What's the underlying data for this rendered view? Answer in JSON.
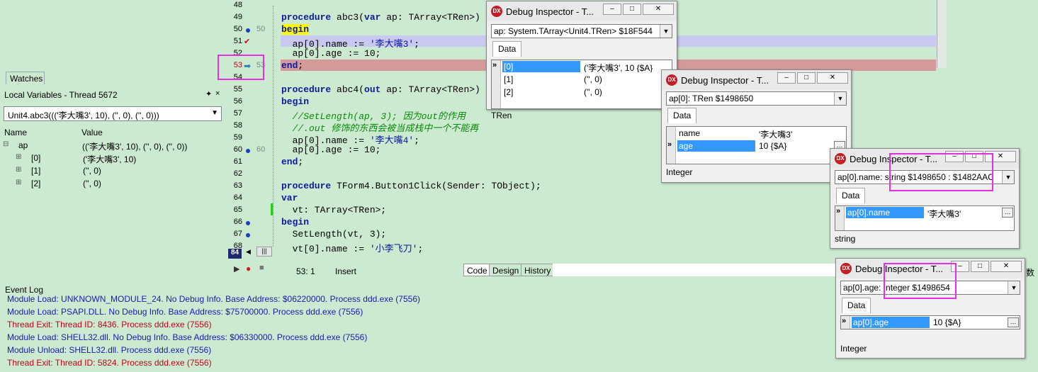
{
  "watches_tab": "Watches",
  "local_vars": {
    "title": "Local Variables - Thread 5672",
    "pin": "✦",
    "close": "×",
    "combo_value": "Unit4.abc3((('李大嘴3', 10), ('', 0), ('', 0)))",
    "col_name": "Name",
    "col_value": "Value",
    "rows": [
      {
        "expander": "⊟",
        "name": "ap",
        "value": "(('李大嘴3', 10), ('', 0), ('', 0))"
      },
      {
        "expander": "⊞",
        "name": "[0]",
        "value": "('李大嘴3', 10)"
      },
      {
        "expander": "⊞",
        "name": "[1]",
        "value": "('', 0)"
      },
      {
        "expander": "⊞",
        "name": "[2]",
        "value": "('', 0)"
      }
    ]
  },
  "editor": {
    "line_numbers": [
      "48",
      "49",
      "50",
      "51",
      "52",
      "53",
      "54",
      "55",
      "56",
      "57",
      "58",
      "59",
      "60",
      "61",
      "62",
      "63",
      "64",
      "65",
      "66",
      "67",
      "68"
    ],
    "second_numbers": {
      "50": "50",
      "53": "53",
      "60": "60"
    },
    "lines": {
      "49": [
        {
          "t": "procedure",
          "c": "kw"
        },
        {
          "t": " abc3(",
          "c": ""
        },
        {
          "t": "var",
          "c": "kw"
        },
        {
          "t": " ap: TArray<TRen>)",
          "c": ""
        }
      ],
      "50": [
        {
          "t": "begin",
          "c": "kw"
        }
      ],
      "51": [
        {
          "t": "  ap[0].name := ",
          "c": ""
        },
        {
          "t": "'李大嘴3'",
          "c": "st"
        },
        {
          "t": ";",
          "c": ""
        }
      ],
      "52": [
        {
          "t": "  ap[0].age := 10;",
          "c": ""
        }
      ],
      "53": [
        {
          "t": "end",
          "c": "kw"
        },
        {
          "t": ";",
          "c": ""
        }
      ],
      "55": [
        {
          "t": "procedure",
          "c": "kw"
        },
        {
          "t": " abc4(",
          "c": ""
        },
        {
          "t": "out",
          "c": "kw"
        },
        {
          "t": " ap: TArray<TRen>)",
          "c": ""
        }
      ],
      "56": [
        {
          "t": "begin",
          "c": "kw"
        }
      ],
      "57": [
        {
          "t": "  //SetLength(ap, 3); 因为out的作用",
          "c": "cm"
        }
      ],
      "58": [
        {
          "t": "  //.out 修饰的东西会被当成栈中一个不能再",
          "c": "cm"
        }
      ],
      "59": [
        {
          "t": "  ap[0].name := ",
          "c": ""
        },
        {
          "t": "'李大嘴4'",
          "c": "st"
        },
        {
          "t": ";",
          "c": ""
        }
      ],
      "60": [
        {
          "t": "  ap[0].age := 10;",
          "c": ""
        }
      ],
      "61": [
        {
          "t": "end",
          "c": "kw"
        },
        {
          "t": ";",
          "c": ""
        }
      ],
      "63": [
        {
          "t": "procedure",
          "c": "kw"
        },
        {
          "t": " TForm4.Button1Click(Sender: TObject);",
          "c": ""
        }
      ],
      "64": [
        {
          "t": "var",
          "c": "kw"
        }
      ],
      "65": [
        {
          "t": "  vt: TArray<TRen>;",
          "c": ""
        }
      ],
      "66": [
        {
          "t": "begin",
          "c": "kw"
        }
      ],
      "67": [
        {
          "t": "  SetLength(vt, 3);",
          "c": ""
        }
      ],
      "68": [
        {
          "t": "  vt[0].name := ",
          "c": ""
        },
        {
          "t": "'小李飞刀'",
          "c": "st"
        },
        {
          "t": ";",
          "c": ""
        }
      ]
    },
    "bottom_line_number": "84",
    "status_pos": "53:  1",
    "status_mode": "Insert",
    "tabs": [
      "Code",
      "Design",
      "History"
    ]
  },
  "event_log": {
    "title": "Event Log",
    "lines": [
      {
        "text": "Module Load: UNKNOWN_MODULE_24. No Debug Info. Base Address: $06220000. Process ddd.exe (7556)",
        "color": "blue"
      },
      {
        "text": "Module Load: PSAPI.DLL. No Debug Info. Base Address: $75700000. Process ddd.exe (7556)",
        "color": "blue"
      },
      {
        "text": "Thread Exit: Thread ID: 8436. Process ddd.exe (7556)",
        "color": "red"
      },
      {
        "text": "Module Load: SHELL32.dll. No Debug Info. Base Address: $06330000. Process ddd.exe (7556)",
        "color": "blue"
      },
      {
        "text": "Module Unload: SHELL32.dll. Process ddd.exe (7556)",
        "color": "blue"
      },
      {
        "text": "Thread Exit: Thread ID: 5824. Process ddd.exe (7556)",
        "color": "red"
      }
    ]
  },
  "inspectors": [
    {
      "title": "Debug Inspector - T...",
      "combo": "ap: System.TArray<Unit4.TRen> $18F544",
      "tab": "Data",
      "rows": [
        {
          "name": "[0]",
          "value": "('李大嘴3', 10 {$A})",
          "selected": true
        },
        {
          "name": "[1]",
          "value": "('', 0)",
          "selected": false
        },
        {
          "name": "[2]",
          "value": "('', 0)",
          "selected": false
        }
      ],
      "footer": "TRen"
    },
    {
      "title": "Debug Inspector - T...",
      "combo": "ap[0]: TRen $1498650",
      "tab": "Data",
      "rows": [
        {
          "name": "name",
          "value": "'李大嘴3'",
          "selected": false
        },
        {
          "name": "age",
          "value": "10 {$A}",
          "selected": true
        }
      ],
      "footer": "Integer"
    },
    {
      "title": "Debug Inspector - T...",
      "combo": "ap[0].name: string $1498650 : $1482AAC",
      "tab": "Data",
      "rows": [
        {
          "name": "ap[0].name",
          "value": "'李大嘴3'",
          "selected": true
        }
      ],
      "footer": "string"
    },
    {
      "title": "Debug Inspector - T...",
      "combo": "ap[0].age: Integer $1498654",
      "tab": "Data",
      "rows": [
        {
          "name": "ap[0].age",
          "value": "10 {$A}",
          "selected": true
        }
      ],
      "footer": "Integer"
    }
  ],
  "window_controls": {
    "min": "–",
    "max": "□",
    "close": "✕"
  },
  "glyphs": {
    "dropdown": "▼",
    "indicator": "»",
    "ellipsis": "…",
    "exec_arrow": "➡",
    "check": "✔",
    "play": "▶",
    "record": "●",
    "stop": "■",
    "scroll_left": "◀",
    "scroll_grip": "|||"
  },
  "cut_text": "数",
  "colors": {
    "bg": "#ccead0",
    "accent": "#3399ff",
    "breakpoint_bg": "#d39a9a",
    "exec_bg": "#c9c8f0",
    "annot": "#e62ee6"
  }
}
